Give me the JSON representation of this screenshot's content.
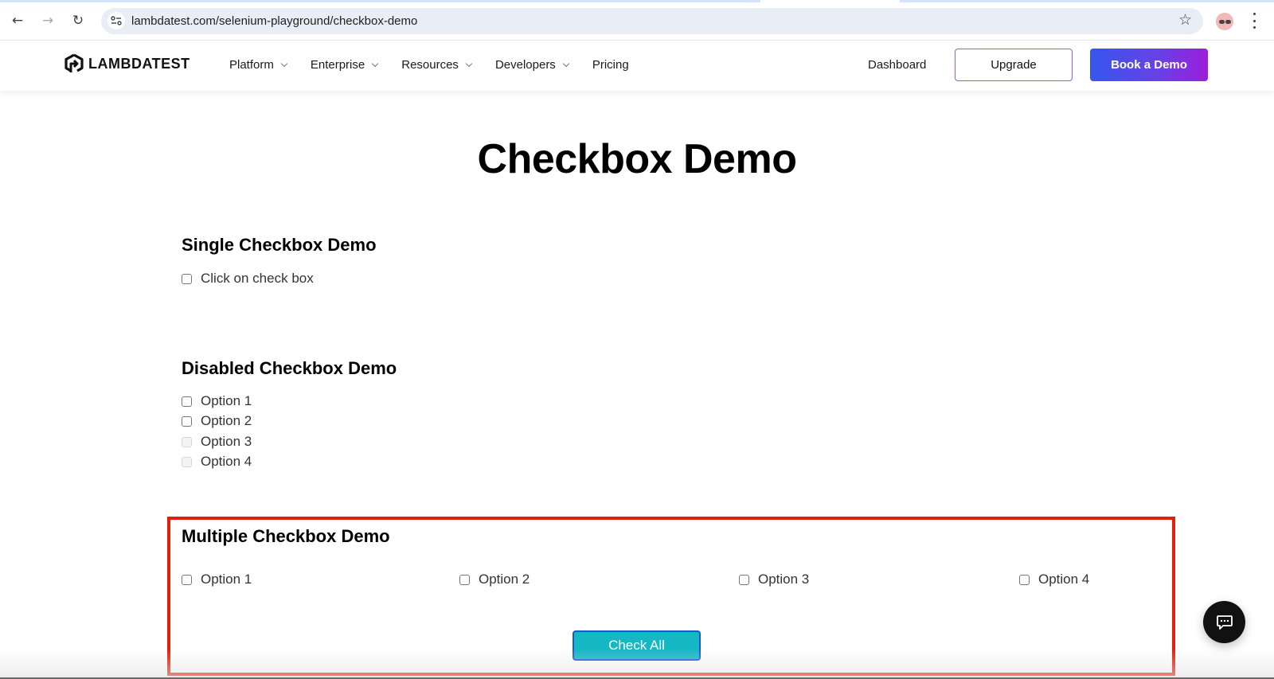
{
  "browser": {
    "url": "lambdatest.com/selenium-playground/checkbox-demo",
    "back_icon": "←",
    "forward_icon": "→",
    "reload_icon": "↻",
    "bookmark_icon": "☆"
  },
  "header": {
    "brand": "LAMBDATEST",
    "nav": [
      {
        "label": "Platform",
        "has_dropdown": true
      },
      {
        "label": "Enterprise",
        "has_dropdown": true
      },
      {
        "label": "Resources",
        "has_dropdown": true
      },
      {
        "label": "Developers",
        "has_dropdown": true
      },
      {
        "label": "Pricing",
        "has_dropdown": false
      }
    ],
    "dashboard": "Dashboard",
    "upgrade": "Upgrade",
    "book_demo": "Book a Demo"
  },
  "main": {
    "title": "Checkbox Demo",
    "single": {
      "heading": "Single Checkbox Demo",
      "label": "Click on check box",
      "checked": false
    },
    "disabled": {
      "heading": "Disabled Checkbox Demo",
      "options": [
        {
          "label": "Option 1",
          "disabled": false,
          "checked": false
        },
        {
          "label": "Option 2",
          "disabled": false,
          "checked": false
        },
        {
          "label": "Option 3",
          "disabled": true,
          "checked": false
        },
        {
          "label": "Option 4",
          "disabled": true,
          "checked": false
        }
      ]
    },
    "multiple": {
      "heading": "Multiple Checkbox Demo",
      "options": [
        {
          "label": "Option 1",
          "checked": false
        },
        {
          "label": "Option 2",
          "checked": false
        },
        {
          "label": "Option 3",
          "checked": false
        },
        {
          "label": "Option 4",
          "checked": false
        }
      ],
      "check_all": "Check All"
    }
  },
  "colors": {
    "highlight": "#e21f0b",
    "check_all_bg": "#14b7c4",
    "demo_gradient_start": "#3657ee",
    "demo_gradient_end": "#9b1ed9"
  }
}
